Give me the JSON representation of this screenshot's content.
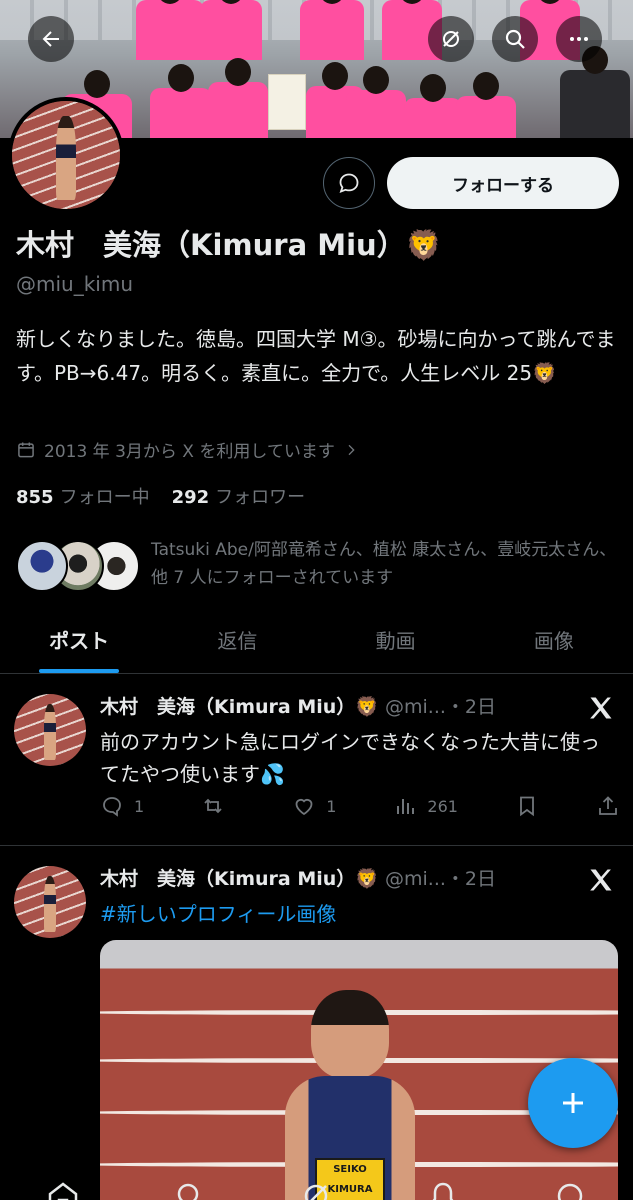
{
  "header": {
    "back_icon": "back-arrow-icon",
    "grok_icon": "grok-icon",
    "search_icon": "search-icon",
    "more_icon": "more-icon"
  },
  "profile": {
    "name": "木村　美海（Kimura Miu）🦁",
    "handle": "@miu_kimu",
    "bio": "新しくなりました。徳島。四国大学 M③。砂場に向かって跳んでます。PB→6.47。明るく。素直に。全力で。人生レベル 25🦁",
    "joined": "2013 年 3月から X を利用しています",
    "following_count": "855",
    "following_label": "フォロー中",
    "followers_count": "292",
    "followers_label": "フォロワー",
    "followed_by": "Tatsuki Abe/阿部竜希さん、植松 康太さん、壹岐元太さん、他 7 人にフォローされています",
    "follow_button": "フォローする"
  },
  "tabs": [
    "ポスト",
    "返信",
    "動画",
    "画像"
  ],
  "posts": [
    {
      "author": "木村　美海（Kimura Miu）🦁",
      "meta": " @mi...・2日",
      "text": "前のアカウント急にログインできなくなった大昔に使ってたやつ使います💦",
      "replies": "1",
      "reposts": "",
      "likes": "1",
      "views": "261"
    },
    {
      "author": "木村　美海（Kimura Miu）🦁",
      "meta": " @mi...・2日",
      "hashtag": "#新しいプロフィール画像",
      "media_bib_brand": "SEIKO",
      "media_bib_name": "KIMURA"
    }
  ],
  "colors": {
    "background": "#000000",
    "accent": "#1d9bf0",
    "text_primary": "#e7e9ea",
    "text_secondary": "#71767b",
    "divider": "#2f3336",
    "banner_shirts": "#ff4fa0"
  }
}
